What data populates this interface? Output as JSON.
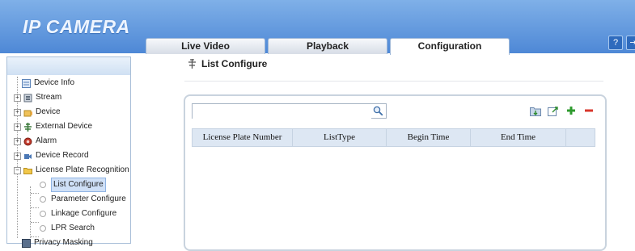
{
  "header": {
    "logo": "IP CAMERA",
    "tabs": [
      "Live Video",
      "Playback",
      "Configuration"
    ],
    "active_tab": "Configuration"
  },
  "sidebar": {
    "items": [
      {
        "label": "Device Info",
        "icon": "info-icon"
      },
      {
        "label": "Stream",
        "icon": "stream-icon"
      },
      {
        "label": "Device",
        "icon": "device-icon"
      },
      {
        "label": "External Device",
        "icon": "external-device-icon"
      },
      {
        "label": "Alarm",
        "icon": "alarm-icon"
      },
      {
        "label": "Device Record",
        "icon": "record-icon"
      },
      {
        "label": "License Plate Recognition",
        "icon": "folder-icon"
      },
      {
        "label": "List Configure",
        "selected": true
      },
      {
        "label": "Parameter Configure"
      },
      {
        "label": "Linkage Configure"
      },
      {
        "label": "LPR Search"
      },
      {
        "label": "Privacy Masking",
        "icon": "privacy-icon"
      }
    ]
  },
  "main": {
    "title": "List Configure",
    "search": {
      "value": "",
      "placeholder": ""
    },
    "toolbar": [
      "import-icon",
      "export-icon",
      "add-icon",
      "delete-icon"
    ],
    "table": {
      "columns": [
        "License Plate Number",
        "ListType",
        "Begin Time",
        "End Time"
      ],
      "rows": []
    }
  },
  "colors": {
    "header_blue": "#5b93dc",
    "add_green": "#2e9a2e",
    "delete_red": "#d8372c"
  }
}
